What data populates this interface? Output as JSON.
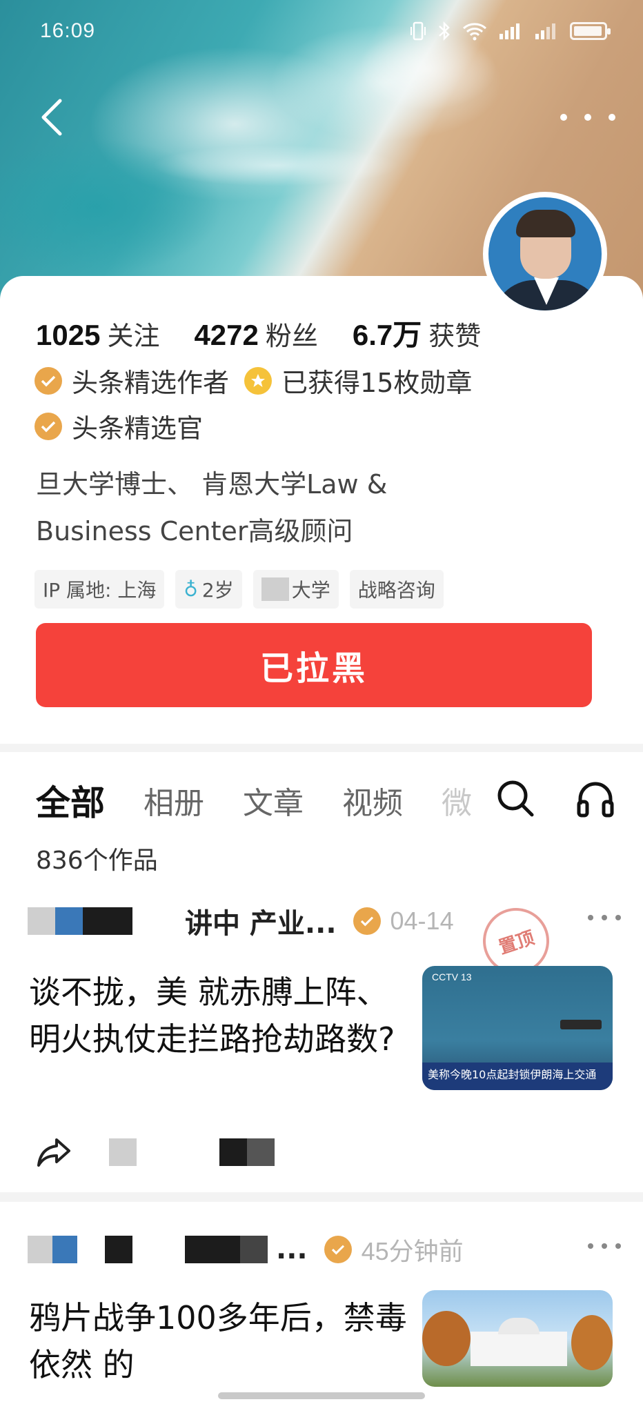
{
  "status_bar": {
    "time": "16:09",
    "icons": [
      "vibrate-icon",
      "bluetooth-icon",
      "wifi-icon",
      "signal-icon",
      "signal-icon",
      "battery-icon"
    ]
  },
  "nav": {
    "back_icon": "chevron-left-icon",
    "more_icon": "more-horizontal-icon"
  },
  "profile": {
    "stats": [
      {
        "value": "1025",
        "label": "关注"
      },
      {
        "value": "4272",
        "label": "粉丝"
      },
      {
        "value": "6.7万",
        "label": "获赞"
      }
    ],
    "badges": [
      {
        "icon": "verified-author-icon",
        "label": "头条精选作者"
      },
      {
        "icon": "medal-icon",
        "label": "已获得15枚勋章"
      },
      {
        "icon": "verified-officer-icon",
        "label": "头条精选官"
      }
    ],
    "bio_line1": "旦大学博士、    肯恩大学Law &",
    "bio_line2": "Business Center高级顾问",
    "tags": [
      {
        "label": "IP 属地: 上海"
      },
      {
        "label": "2岁",
        "icon": "gender-icon"
      },
      {
        "label": "大学"
      },
      {
        "label": "战略咨询"
      }
    ],
    "blocked_label": "已拉黑"
  },
  "tabs": {
    "items": [
      "全部",
      "相册",
      "文章",
      "视频",
      "微"
    ],
    "active": "全部",
    "search_icon": "search-icon",
    "listen_icon": "headphones-icon"
  },
  "works_count": "836个作品",
  "feed": [
    {
      "author": "讲中    产业...",
      "time": "04-14",
      "stamp": "置顶",
      "title": "谈不拢，美    就赤膊上阵、明火执仗走拦路抢劫路数?",
      "thumb": {
        "kind": "news",
        "logo": "CCTV 13",
        "ticker": "美称今晚10点起封锁伊朗海上交通"
      }
    },
    {
      "author": "...",
      "time": "45分钟前",
      "title": "鸦片战争100多年后，禁毒依然    的",
      "thumb": {
        "kind": "building"
      }
    }
  ],
  "colors": {
    "accent_red": "#f5423b",
    "verified_gold": "#e9a64b",
    "medal_yellow": "#f5c23a"
  }
}
